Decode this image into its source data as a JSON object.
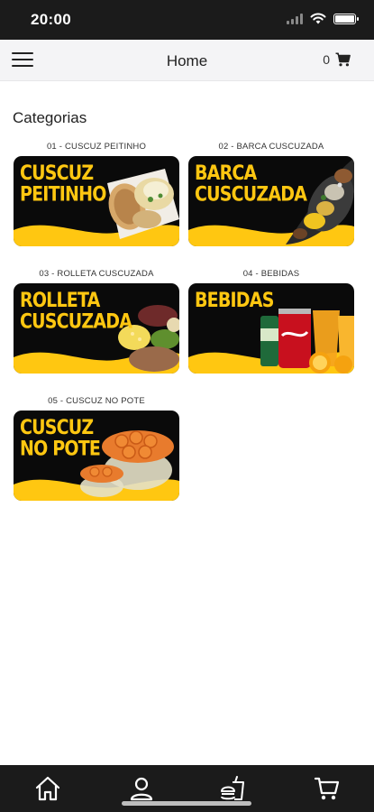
{
  "status_bar": {
    "time": "20:00",
    "icons": [
      "signal-icon",
      "wifi-icon",
      "battery-icon"
    ]
  },
  "header": {
    "menu_icon": "menu-icon",
    "title": "Home",
    "cart_count": "0",
    "cart_icon": "cart-icon"
  },
  "section": {
    "title": "Categorias"
  },
  "categories": [
    {
      "label": "01 - CUSCUZ PEITINHO",
      "banner_line1": "CUSCUZ",
      "banner_line2": "PEITINHO"
    },
    {
      "label": "02 - BARCA CUSCUZADA",
      "banner_line1": "BARCA",
      "banner_line2": "CUSCUZADA"
    },
    {
      "label": "03 - ROLLETA CUSCUZADA",
      "banner_line1": "ROLLETA",
      "banner_line2": "CUSCUZADA"
    },
    {
      "label": "04 - BEBIDAS",
      "banner_line1": "BEBIDAS",
      "banner_line2": ""
    },
    {
      "label": "05 - CUSCUZ NO POTE",
      "banner_line1": "CUSCUZ",
      "banner_line2": "NO POTE"
    }
  ],
  "colors": {
    "brand_yellow": "#ffc711",
    "banner_black": "#0a0a0a",
    "bar_dark": "#1b1b1b"
  },
  "bottom_nav": {
    "items": [
      "home-icon",
      "user-icon",
      "food-icon",
      "cart-icon"
    ]
  }
}
